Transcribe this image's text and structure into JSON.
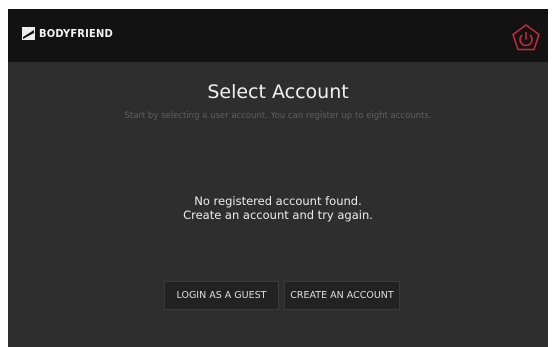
{
  "header": {
    "brand": "BODYFRIEND",
    "power_icon": "power-icon",
    "power_color": "#c8283c"
  },
  "main": {
    "title": "Select Account",
    "subtitle": "Start by selecting a user account. You can register up to eight accounts.",
    "empty_line1": "No registered account found.",
    "empty_line2": "Create an account and try again."
  },
  "actions": {
    "guest_label": "LOGIN AS A GUEST",
    "create_label": "CREATE AN ACCOUNT"
  },
  "colors": {
    "background": "#2e2e2e",
    "header": "#121212",
    "button": "#222222"
  }
}
